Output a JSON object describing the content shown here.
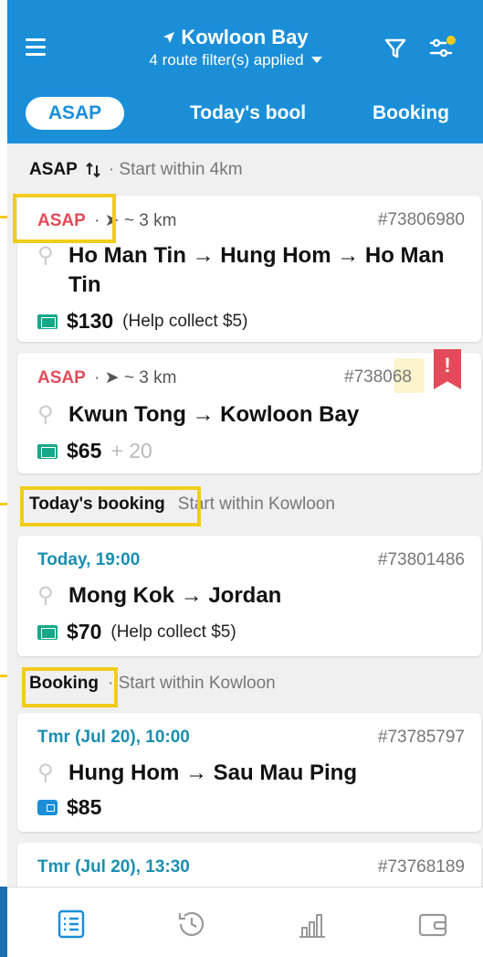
{
  "header": {
    "location": "Kowloon Bay",
    "filter_summary": "4 route filter(s) applied",
    "tabs": [
      "ASAP",
      "Today's bool",
      "Booking"
    ]
  },
  "sections": {
    "asap": {
      "title": "ASAP",
      "subtitle": "· Start within 4km"
    },
    "today": {
      "title": "Today's booking",
      "subtitle": "Start within Kowloon"
    },
    "booking": {
      "title": "Booking",
      "subtitle": "· Start within Kowloon"
    }
  },
  "jobs": [
    {
      "tag": "ASAP",
      "distance": "~ 3 km",
      "ref": "#73806980",
      "route": "Ho Man Tin → Hung Hom → Ho Man Tin",
      "price": "$130",
      "note": "(Help collect $5)"
    },
    {
      "tag": "ASAP",
      "distance": "~ 3 km",
      "ref": "#738068",
      "route": "Kwun Tong → Kowloon Bay",
      "price": "$65",
      "extra": "+ 20",
      "flag": "!"
    },
    {
      "tag": "Today, 19:00",
      "ref": "#73801486",
      "route": "Mong Kok → Jordan",
      "price": "$70",
      "note": "(Help collect $5)"
    },
    {
      "tag": "Tmr (Jul 20), 10:00",
      "ref": "#73785797",
      "route": "Hung Hom → Sau Mau Ping",
      "price": "$85"
    },
    {
      "tag": "Tmr (Jul 20), 13:30",
      "ref": "#73768189"
    }
  ],
  "colors": {
    "primary": "#1a8fd8",
    "asap_red": "#e34b5a",
    "time_teal": "#1a8fb0",
    "highlight_yellow": "#f2cc1b",
    "cash_green": "#16a888"
  },
  "nav": [
    "list-icon",
    "history-icon",
    "stats-icon",
    "wallet-icon"
  ]
}
